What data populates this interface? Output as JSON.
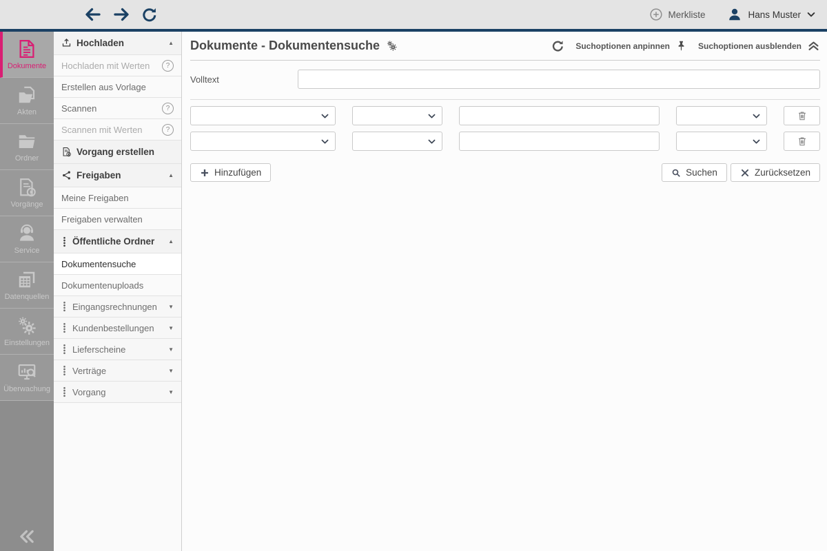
{
  "topbar": {
    "merkliste_label": "Merkliste",
    "user_name": "Hans Muster"
  },
  "sidebar": {
    "items": [
      {
        "label": "Dokumente",
        "icon": "document-icon",
        "active": true
      },
      {
        "label": "Akten",
        "icon": "files-icon",
        "active": false
      },
      {
        "label": "Ordner",
        "icon": "folder-icon",
        "active": false
      },
      {
        "label": "Vorgänge",
        "icon": "process-icon",
        "active": false
      },
      {
        "label": "Service",
        "icon": "headset-icon",
        "active": false
      },
      {
        "label": "Datenquellen",
        "icon": "datasource-icon",
        "active": false
      },
      {
        "label": "Einstellungen",
        "icon": "gears-icon",
        "active": false
      },
      {
        "label": "Überwachung",
        "icon": "monitoring-icon",
        "active": false
      }
    ]
  },
  "menu": {
    "items": [
      {
        "label": "Hochladen",
        "style": "header",
        "icon": "upload-icon",
        "right": "collapse-up"
      },
      {
        "label": "Hochladen mit Werten",
        "style": "disabled",
        "icon": null,
        "right": "help"
      },
      {
        "label": "Erstellen aus Vorlage",
        "style": "item",
        "icon": null,
        "right": null
      },
      {
        "label": "Scannen",
        "style": "item",
        "icon": null,
        "right": "help"
      },
      {
        "label": "Scannen mit Werten",
        "style": "disabled",
        "icon": null,
        "right": "help"
      },
      {
        "label": "Vorgang erstellen",
        "style": "header",
        "icon": "process-icon",
        "right": null
      },
      {
        "label": "Freigaben",
        "style": "header",
        "icon": "share-icon",
        "right": "collapse-up"
      },
      {
        "label": "Meine Freigaben",
        "style": "item",
        "icon": null,
        "right": null
      },
      {
        "label": "Freigaben verwalten",
        "style": "item",
        "icon": null,
        "right": null
      },
      {
        "label": "Öffentliche Ordner",
        "style": "header",
        "icon": "dots-icon",
        "right": "collapse-up"
      },
      {
        "label": "Dokumentensuche",
        "style": "selected",
        "icon": null,
        "right": null
      },
      {
        "label": "Dokumentenuploads",
        "style": "item",
        "icon": null,
        "right": null
      },
      {
        "label": "Eingangsrechnungen",
        "style": "subheader",
        "icon": "dots-icon",
        "right": "collapse-down"
      },
      {
        "label": "Kundenbestellungen",
        "style": "subheader",
        "icon": "dots-icon",
        "right": "collapse-down"
      },
      {
        "label": "Lieferscheine",
        "style": "subheader",
        "icon": "dots-icon",
        "right": "collapse-down"
      },
      {
        "label": "Verträge",
        "style": "subheader",
        "icon": "dots-icon",
        "right": "collapse-down"
      },
      {
        "label": "Vorgang",
        "style": "subheader",
        "icon": "dots-icon",
        "right": "collapse-down"
      }
    ]
  },
  "content": {
    "title": "Dokumente - Dokumentensuche",
    "pin_label": "Suchoptionen anpinnen",
    "hide_label": "Suchoptionen ausblenden",
    "fulltext_label": "Volltext",
    "fulltext_value": "",
    "filter_rows": [
      {
        "field": "",
        "operator": "",
        "value": "",
        "connector": ""
      },
      {
        "field": "",
        "operator": "",
        "value": "",
        "connector": ""
      }
    ],
    "add_label": "Hinzufügen",
    "search_label": "Suchen",
    "reset_label": "Zurücksetzen"
  },
  "colors": {
    "accent_pink": "#d91e73",
    "navy": "#1b4164",
    "topbar_bg": "#e4e4e4",
    "rail_bg": "#8d8d8d"
  }
}
